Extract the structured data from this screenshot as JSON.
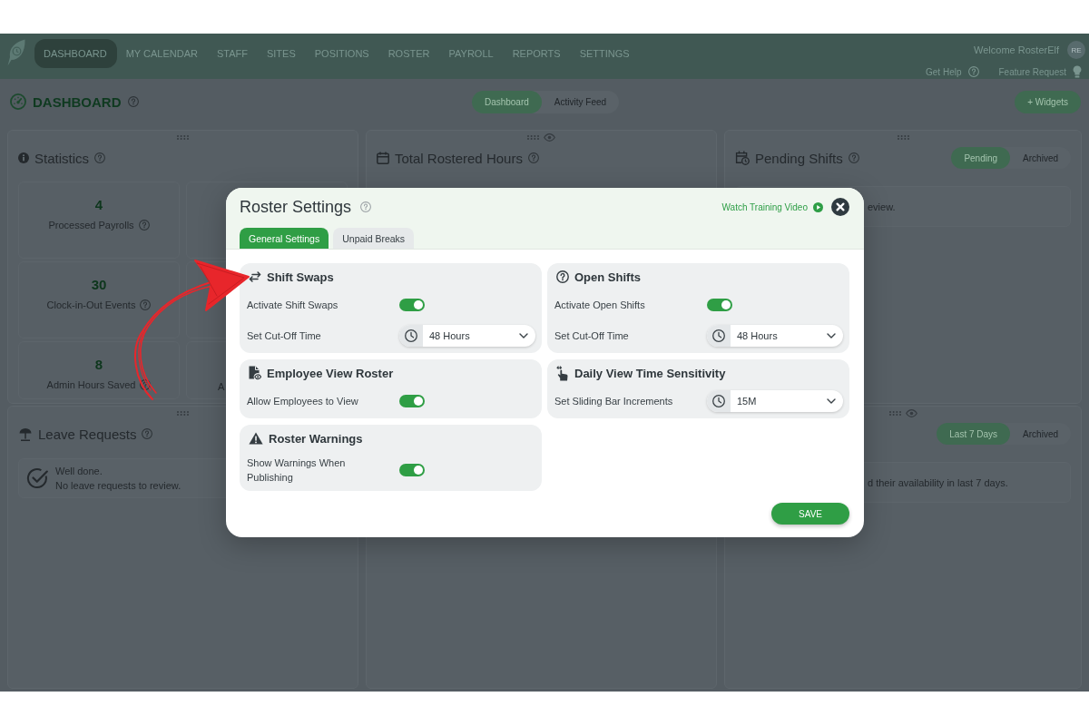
{
  "nav": {
    "items": [
      {
        "label": "DASHBOARD",
        "selected": true
      },
      {
        "label": "MY CALENDAR",
        "selected": false
      },
      {
        "label": "STAFF",
        "selected": false
      },
      {
        "label": "SITES",
        "selected": false
      },
      {
        "label": "POSITIONS",
        "selected": false
      },
      {
        "label": "ROSTER",
        "selected": false
      },
      {
        "label": "PAYROLL",
        "selected": false
      },
      {
        "label": "REPORTS",
        "selected": false
      },
      {
        "label": "SETTINGS",
        "selected": false
      }
    ],
    "welcome": "Welcome RosterElf",
    "avatar": "RE",
    "links": [
      "Get Help",
      "Feature Request"
    ]
  },
  "page_header": {
    "title": "DASHBOARD",
    "view_tabs": [
      {
        "label": "Dashboard",
        "selected": true
      },
      {
        "label": "Activity Feed",
        "selected": false
      }
    ],
    "widgets_button": "+ Widgets"
  },
  "widgets": [
    {
      "kind": "stats",
      "title": "Statistics",
      "hideable": false,
      "stats": [
        {
          "value": "4",
          "label": "Processed Payrolls"
        },
        {
          "value": "30",
          "label": "Clock-in-Out Events"
        },
        {
          "value": "8",
          "label": "Admin Hours Saved"
        }
      ],
      "cut_stat_label": "A"
    },
    {
      "kind": "titled",
      "title": "Total Rostered Hours",
      "hideable": true
    },
    {
      "kind": "tabbed",
      "title": "Pending Shifts",
      "hideable": false,
      "tabs": [
        {
          "label": "Pending",
          "selected": true
        },
        {
          "label": "Archived",
          "selected": false
        }
      ],
      "message": "eview."
    },
    {
      "kind": "note",
      "title": "Leave Requests",
      "hideable": false,
      "heading": "Well done.",
      "message": "No leave requests to review."
    },
    {
      "kind": "empty"
    },
    {
      "kind": "tabbed",
      "hideable": true,
      "tabs": [
        {
          "label": "Last 7 Days",
          "selected": true
        },
        {
          "label": "Archived",
          "selected": false
        }
      ],
      "message": "d their availability in last 7 days."
    }
  ],
  "modal": {
    "title": "Roster Settings",
    "video_link": "Watch Training Video",
    "tabs": [
      {
        "label": "General Settings",
        "selected": true
      },
      {
        "label": "Unpaid Breaks",
        "selected": false
      }
    ],
    "sections": [
      {
        "title": "Shift Swaps",
        "rows": [
          {
            "kind": "toggle",
            "label": "Activate Shift Swaps",
            "on": true
          },
          {
            "kind": "select",
            "label": "Set Cut-Off Time",
            "value": "48 Hours"
          }
        ]
      },
      {
        "title": "Open Shifts",
        "rows": [
          {
            "kind": "toggle",
            "label": "Activate Open Shifts",
            "on": true
          },
          {
            "kind": "select",
            "label": "Set Cut-Off Time",
            "value": "48 Hours"
          }
        ]
      },
      {
        "title": "Employee View Roster",
        "rows": [
          {
            "kind": "toggle",
            "label": "Allow Employees to View",
            "on": true
          }
        ]
      },
      {
        "title": "Daily View Time Sensitivity",
        "rows": [
          {
            "kind": "select",
            "label": "Set Sliding Bar Increments",
            "value": "15M"
          }
        ]
      },
      {
        "title": "Roster Warnings",
        "rows": [
          {
            "kind": "toggle",
            "label": "Show Warnings When Publishing",
            "on": true
          }
        ]
      }
    ],
    "save_button": "SAVE"
  }
}
